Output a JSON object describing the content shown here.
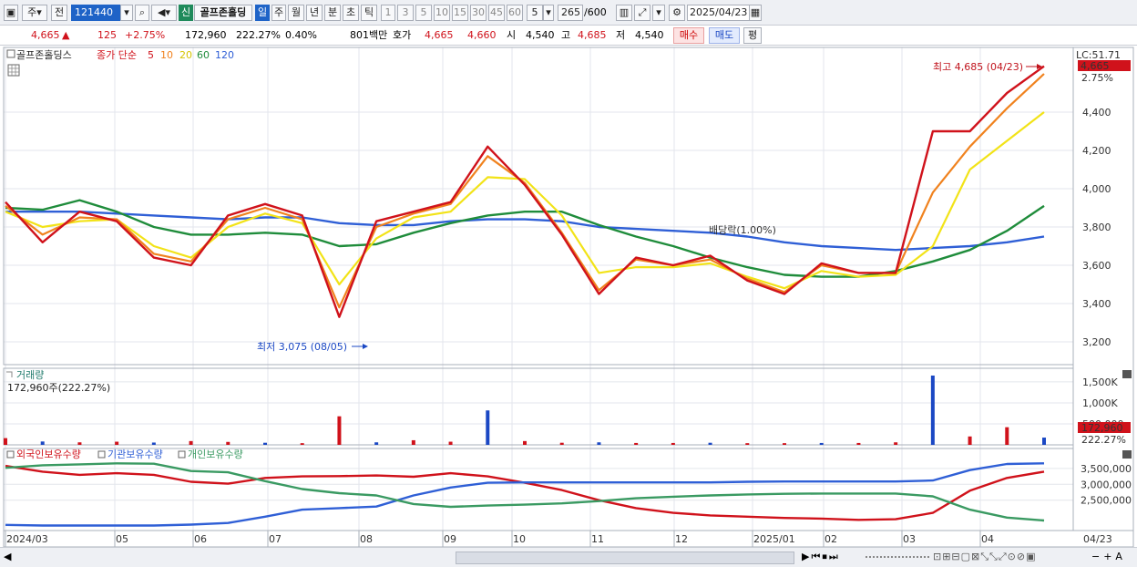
{
  "toolbar": {
    "period_week": "주",
    "period_prev": "전",
    "code": "121440",
    "new_badge": "신",
    "stock_name": "골프존홀딩",
    "tabs": [
      "일",
      "주",
      "월",
      "년",
      "분",
      "초",
      "틱"
    ],
    "intervals": [
      "1",
      "3",
      "5",
      "10",
      "15",
      "30",
      "45",
      "60"
    ],
    "interval_value": "5",
    "count_value": "265",
    "count_max": "/600",
    "date_value": "2025/04/23"
  },
  "info": {
    "price": "4,665",
    "arrow": "▲",
    "change": "125",
    "change_pct": "+2.75%",
    "volume": "172,960",
    "volume_pct": "222.27%",
    "turnover_pct": "0.40%",
    "amount": "801백만",
    "quote_label": "호가",
    "ask": "4,665",
    "bid": "4,660",
    "open_label": "시",
    "open": "4,540",
    "high_label": "고",
    "high": "4,685",
    "low_label": "저",
    "low": "4,540",
    "buy": "매수",
    "sell": "매도",
    "eval": "평"
  },
  "legend": {
    "name": "골프존홀딩스",
    "ma_label": "종가 단순",
    "ma5": "5",
    "ma10": "10",
    "ma20": "20",
    "ma60": "60",
    "ma120": "120"
  },
  "annotations": {
    "high": "최고 4,685 (04/23)",
    "low": "최저 3,075 (08/05)",
    "dividend": "배당락(1.00%)",
    "lc": "LC:51.71",
    "last_price": "4,665",
    "last_pct": "2.75%"
  },
  "volume_panel": {
    "title": "거래량",
    "summary": "172,960주(222.27%)",
    "last_value": "172,960",
    "last_pct": "222.27%"
  },
  "holdings_panel": {
    "foreign": "외국인보유수량",
    "institution": "기관보유수량",
    "individual": "개인보유수량"
  },
  "colors": {
    "up": "#d0121b",
    "down": "#1b48c4",
    "ma5": "#d0121b",
    "ma10": "#f0821e",
    "ma20": "#f2e318",
    "ma60": "#1f8c3b",
    "ma120": "#2f5fd6",
    "foreign": "#d0121b",
    "institution": "#2f5fd6",
    "individual": "#3a9a62"
  },
  "chart_data": [
    {
      "type": "line",
      "title": "골프존홀딩스",
      "x": [
        "2024/03",
        "05",
        "06",
        "07",
        "08",
        "09",
        "10",
        "11",
        "12",
        "2025/01",
        "02",
        "03",
        "04",
        "04/23"
      ],
      "y_ticks": [
        "3,200",
        "3,400",
        "3,600",
        "3,800",
        "4,000",
        "4,200",
        "4,400"
      ],
      "ylim": [
        3100,
        4700
      ],
      "series": [
        {
          "name": "5",
          "values": [
            3930,
            3720,
            3880,
            3830,
            3640,
            3600,
            3860,
            3920,
            3860,
            3330,
            3830,
            3880,
            3930,
            4220,
            4020,
            3760,
            3450,
            3640,
            3600,
            3650,
            3520,
            3450,
            3610,
            3560,
            3560,
            4300,
            4300,
            4500,
            4640
          ]
        },
        {
          "name": "10",
          "values": [
            3910,
            3760,
            3850,
            3840,
            3660,
            3620,
            3840,
            3900,
            3840,
            3380,
            3800,
            3870,
            3920,
            4170,
            4030,
            3770,
            3470,
            3630,
            3600,
            3630,
            3530,
            3460,
            3600,
            3560,
            3560,
            3980,
            4220,
            4420,
            4600
          ]
        },
        {
          "name": "20",
          "values": [
            3880,
            3800,
            3830,
            3840,
            3700,
            3640,
            3800,
            3870,
            3820,
            3500,
            3740,
            3850,
            3880,
            4060,
            4050,
            3860,
            3560,
            3590,
            3590,
            3610,
            3540,
            3480,
            3570,
            3540,
            3550,
            3700,
            4100,
            4250,
            4400
          ]
        },
        {
          "name": "60",
          "values": [
            3900,
            3890,
            3940,
            3880,
            3800,
            3760,
            3760,
            3770,
            3760,
            3700,
            3710,
            3770,
            3820,
            3860,
            3880,
            3880,
            3810,
            3750,
            3700,
            3640,
            3590,
            3550,
            3540,
            3540,
            3570,
            3620,
            3680,
            3780,
            3910
          ]
        },
        {
          "name": "120",
          "values": [
            3880,
            3880,
            3880,
            3870,
            3860,
            3850,
            3840,
            3850,
            3850,
            3820,
            3810,
            3810,
            3830,
            3840,
            3840,
            3830,
            3800,
            3790,
            3780,
            3770,
            3750,
            3720,
            3700,
            3690,
            3680,
            3690,
            3700,
            3720,
            3750
          ]
        }
      ]
    },
    {
      "type": "bar",
      "title": "거래량",
      "x": [
        "2024/03",
        "05",
        "06",
        "07",
        "08",
        "09",
        "10",
        "11",
        "12",
        "2025/01",
        "02",
        "03",
        "04",
        "04/23"
      ],
      "y_ticks": [
        "500,000",
        "1,000K",
        "1,500K"
      ],
      "ylim": [
        0,
        1650000
      ],
      "values": [
        160000,
        80000,
        60000,
        75000,
        55000,
        90000,
        70000,
        50000,
        40000,
        680000,
        60000,
        110000,
        75000,
        820000,
        90000,
        50000,
        60000,
        45000,
        45000,
        50000,
        40000,
        40000,
        45000,
        45000,
        60000,
        1650000,
        200000,
        420000,
        172960
      ],
      "series": [
        {
          "name": "거래량",
          "values": [
            160000,
            80000,
            60000,
            75000,
            55000,
            90000,
            70000,
            50000,
            40000,
            680000,
            60000,
            110000,
            75000,
            820000,
            90000,
            50000,
            60000,
            45000,
            45000,
            50000,
            40000,
            40000,
            45000,
            45000,
            60000,
            1650000,
            200000,
            420000,
            172960
          ]
        }
      ]
    },
    {
      "type": "line",
      "title": "",
      "x": [
        "2024/03",
        "05",
        "06",
        "07",
        "08",
        "09",
        "10",
        "11",
        "12",
        "2025/01",
        "02",
        "03",
        "04",
        "04/23"
      ],
      "y_ticks": [
        "2,500,000",
        "3,000,000",
        "3,500,000"
      ],
      "ylim": [
        1600000,
        3900000
      ],
      "series": [
        {
          "name": "외국인보유수량",
          "values": [
            3580000,
            3400000,
            3300000,
            3350000,
            3300000,
            3080000,
            3020000,
            3200000,
            3250000,
            3260000,
            3280000,
            3240000,
            3350000,
            3250000,
            3050000,
            2820000,
            2500000,
            2250000,
            2100000,
            2020000,
            1980000,
            1940000,
            1920000,
            1880000,
            1900000,
            2100000,
            2800000,
            3200000,
            3400000
          ]
        },
        {
          "name": "기관보유수량",
          "values": [
            1720000,
            1700000,
            1700000,
            1700000,
            1700000,
            1730000,
            1780000,
            1980000,
            2200000,
            2250000,
            2300000,
            2650000,
            2900000,
            3050000,
            3060000,
            3060000,
            3060000,
            3060000,
            3060000,
            3060000,
            3080000,
            3090000,
            3090000,
            3090000,
            3090000,
            3120000,
            3450000,
            3640000,
            3660000
          ]
        },
        {
          "name": "개인보유수량",
          "values": [
            3520000,
            3600000,
            3630000,
            3660000,
            3650000,
            3420000,
            3380000,
            3100000,
            2850000,
            2720000,
            2650000,
            2380000,
            2290000,
            2330000,
            2360000,
            2400000,
            2470000,
            2560000,
            2610000,
            2650000,
            2680000,
            2700000,
            2710000,
            2710000,
            2710000,
            2620000,
            2200000,
            1950000,
            1860000
          ]
        }
      ]
    }
  ]
}
